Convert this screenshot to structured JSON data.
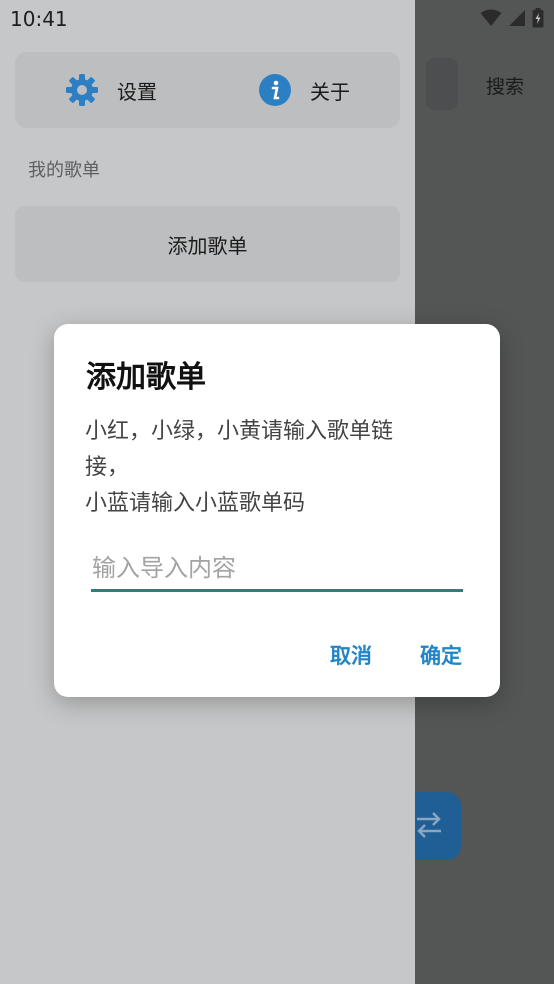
{
  "status_bar": {
    "time": "10:41"
  },
  "main": {
    "search_label": "搜索"
  },
  "drawer": {
    "settings_label": "设置",
    "about_label": "关于",
    "section_title": "我的歌单",
    "add_playlist_label": "添加歌单"
  },
  "dialog": {
    "title": "添加歌单",
    "message_line1": "小红，小绿，小黄请输入歌单链",
    "message_line2": "接，",
    "message_line3": "小蓝请输入小蓝歌单码",
    "input_placeholder": "输入导入内容",
    "input_value": "",
    "cancel_label": "取消",
    "confirm_label": "确定"
  },
  "colors": {
    "accent": "#2185c7",
    "input_underline": "#1d877c",
    "fab": "#1f5f96"
  },
  "icons": {
    "settings": "gear-icon",
    "about": "info-icon",
    "fab": "swap-arrows-icon"
  }
}
